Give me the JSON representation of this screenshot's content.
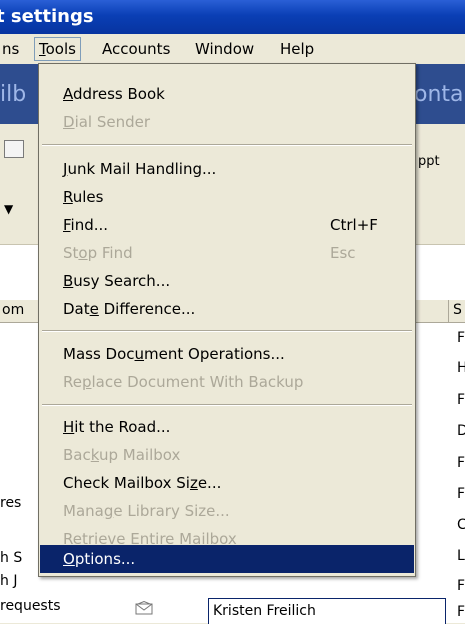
{
  "window": {
    "title": "t settings"
  },
  "menubar": {
    "items": [
      {
        "label": "ns"
      },
      {
        "label": "Tools"
      },
      {
        "label": "Accounts"
      },
      {
        "label": "Window"
      },
      {
        "label": "Help"
      }
    ]
  },
  "background": {
    "banner_left": "ilb",
    "banner_right": "onta",
    "toolbar_text": "ppt",
    "column_header_left": "om",
    "column_header_right": "S",
    "left_rows": [
      "res",
      "h S",
      "h J",
      "requests"
    ],
    "right_letters": [
      "F",
      "H",
      "F",
      "D",
      "F",
      "F",
      "C",
      "L",
      "F",
      "F"
    ],
    "sender": "Kristen Freilich"
  },
  "tools_menu": {
    "items": [
      {
        "label": "Address Book",
        "enabled": true
      },
      {
        "label": "Dial Sender",
        "enabled": false
      },
      {
        "label": "Junk Mail Handling...",
        "enabled": true
      },
      {
        "label": "Rules",
        "enabled": true
      },
      {
        "label": "Find...",
        "shortcut": "Ctrl+F",
        "enabled": true
      },
      {
        "label": "Stop Find",
        "shortcut": "Esc",
        "enabled": false
      },
      {
        "label": "Busy Search...",
        "enabled": true
      },
      {
        "label": "Date Difference...",
        "enabled": true
      },
      {
        "label": "Mass Document Operations...",
        "enabled": true
      },
      {
        "label": "Replace Document With Backup",
        "enabled": false
      },
      {
        "label": "Hit the Road...",
        "enabled": true
      },
      {
        "label": "Backup Mailbox",
        "enabled": false
      },
      {
        "label": "Check Mailbox Size...",
        "enabled": true
      },
      {
        "label": "Manage Library Size...",
        "enabled": false
      },
      {
        "label": "Retrieve Entire Mailbox",
        "enabled": false
      },
      {
        "label": "Options...",
        "enabled": true,
        "selected": true
      }
    ]
  },
  "colors": {
    "menu_highlight": "#0a246a",
    "menu_background": "#ece9d8",
    "disabled_text": "#aca899",
    "titlebar": "#0a3fb5"
  }
}
